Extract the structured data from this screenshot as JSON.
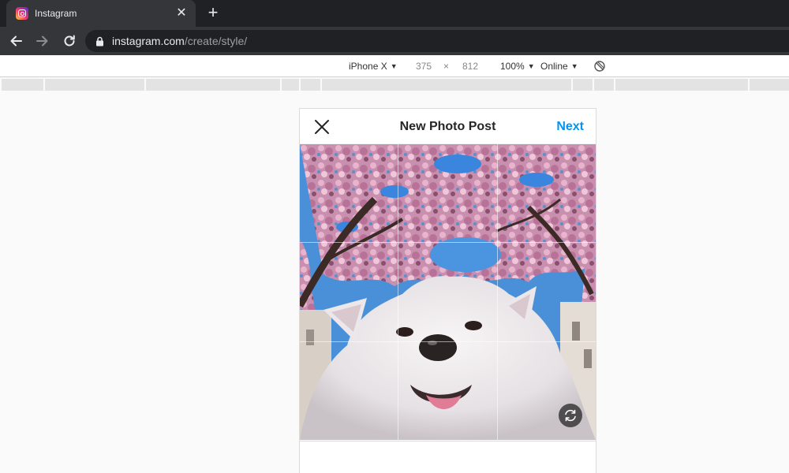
{
  "browser": {
    "tab": {
      "title": "Instagram",
      "favicon": "instagram-icon",
      "close": "✕"
    },
    "new_tab": "+",
    "url_host": "instagram.com",
    "url_path": "/create/style/"
  },
  "device_toolbar": {
    "device": "iPhone X",
    "width": "375",
    "times": "×",
    "height": "812",
    "zoom": "100%",
    "network": "Online",
    "caret": "▼"
  },
  "post_editor": {
    "title": "New Photo Post",
    "next_label": "Next",
    "close_icon": "close-icon",
    "rotate_icon": "rotate-icon"
  },
  "colors": {
    "accent": "#0095f6",
    "browser_dark": "#202124",
    "browser_toolbar": "#35363a"
  }
}
